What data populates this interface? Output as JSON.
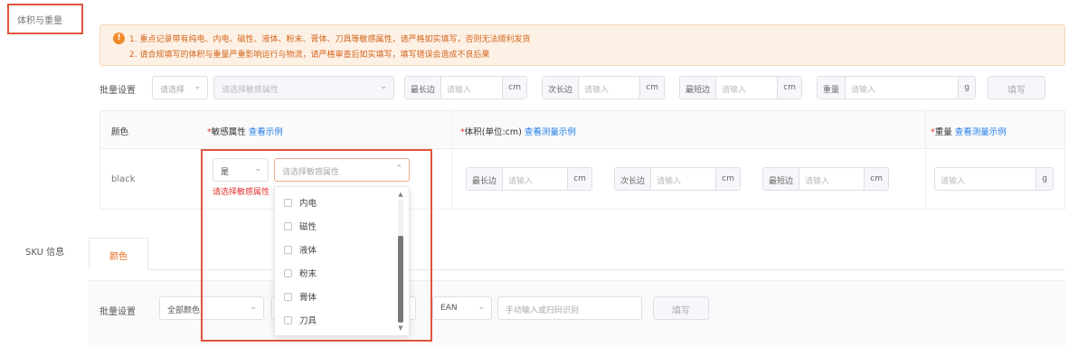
{
  "section": {
    "title": "体积与重量"
  },
  "notice": {
    "line1": "1. 重点记录带有纯电、内电、磁性、液体、粉末、膏体、刀具等敏感属性，请严格如实填写，否则无法顺利发货",
    "line2": "2. 请合规填写的体积与重量严重影响运行与物流，请严格审查后如实填写，填写错误会造成不良后果"
  },
  "batch": {
    "label": "批量设置",
    "select1_placeholder": "请选择",
    "select2_placeholder": "请选择敏感属性",
    "length_prefix": "最长边",
    "width_prefix": "次长边",
    "height_prefix": "最短边",
    "weight_prefix": "重量",
    "input_placeholder": "请输入",
    "unit_cm": "cm",
    "unit_g": "g",
    "fill_button": "填写"
  },
  "table": {
    "col_color": "颜色",
    "col_sensitive": "敏感属性",
    "col_sensitive_link": "查看示例",
    "col_volume": "体积(单位:cm)",
    "col_volume_link": "查看测量示例",
    "col_weight": "重量",
    "col_weight_link": "查看测量示例",
    "row": {
      "color": "black",
      "sensitive_yesno": "是",
      "sensitive_placeholder": "请选择敏感属性",
      "error": "请选择敏感属性",
      "length_prefix": "最长边",
      "width_prefix": "次长边",
      "height_prefix": "最短边",
      "input_placeholder": "请输入",
      "unit_cm": "cm",
      "unit_g": "g"
    }
  },
  "dropdown": {
    "options": [
      "内电",
      "磁性",
      "液体",
      "粉末",
      "膏体",
      "刀具"
    ]
  },
  "sku": {
    "label": "SKU 信息",
    "tab": "颜色",
    "batch_label": "批量设置",
    "color_select": "全部颜色",
    "ean_select": "EAN",
    "ean_placeholder": "手动输入或扫码识别",
    "fill_button": "填写"
  },
  "colors": {
    "accent": "#e86d1f",
    "link": "#1f7be8",
    "error": "#e3342f",
    "highlight": "#e0543f",
    "notice_bg": "#fdf1e6"
  }
}
